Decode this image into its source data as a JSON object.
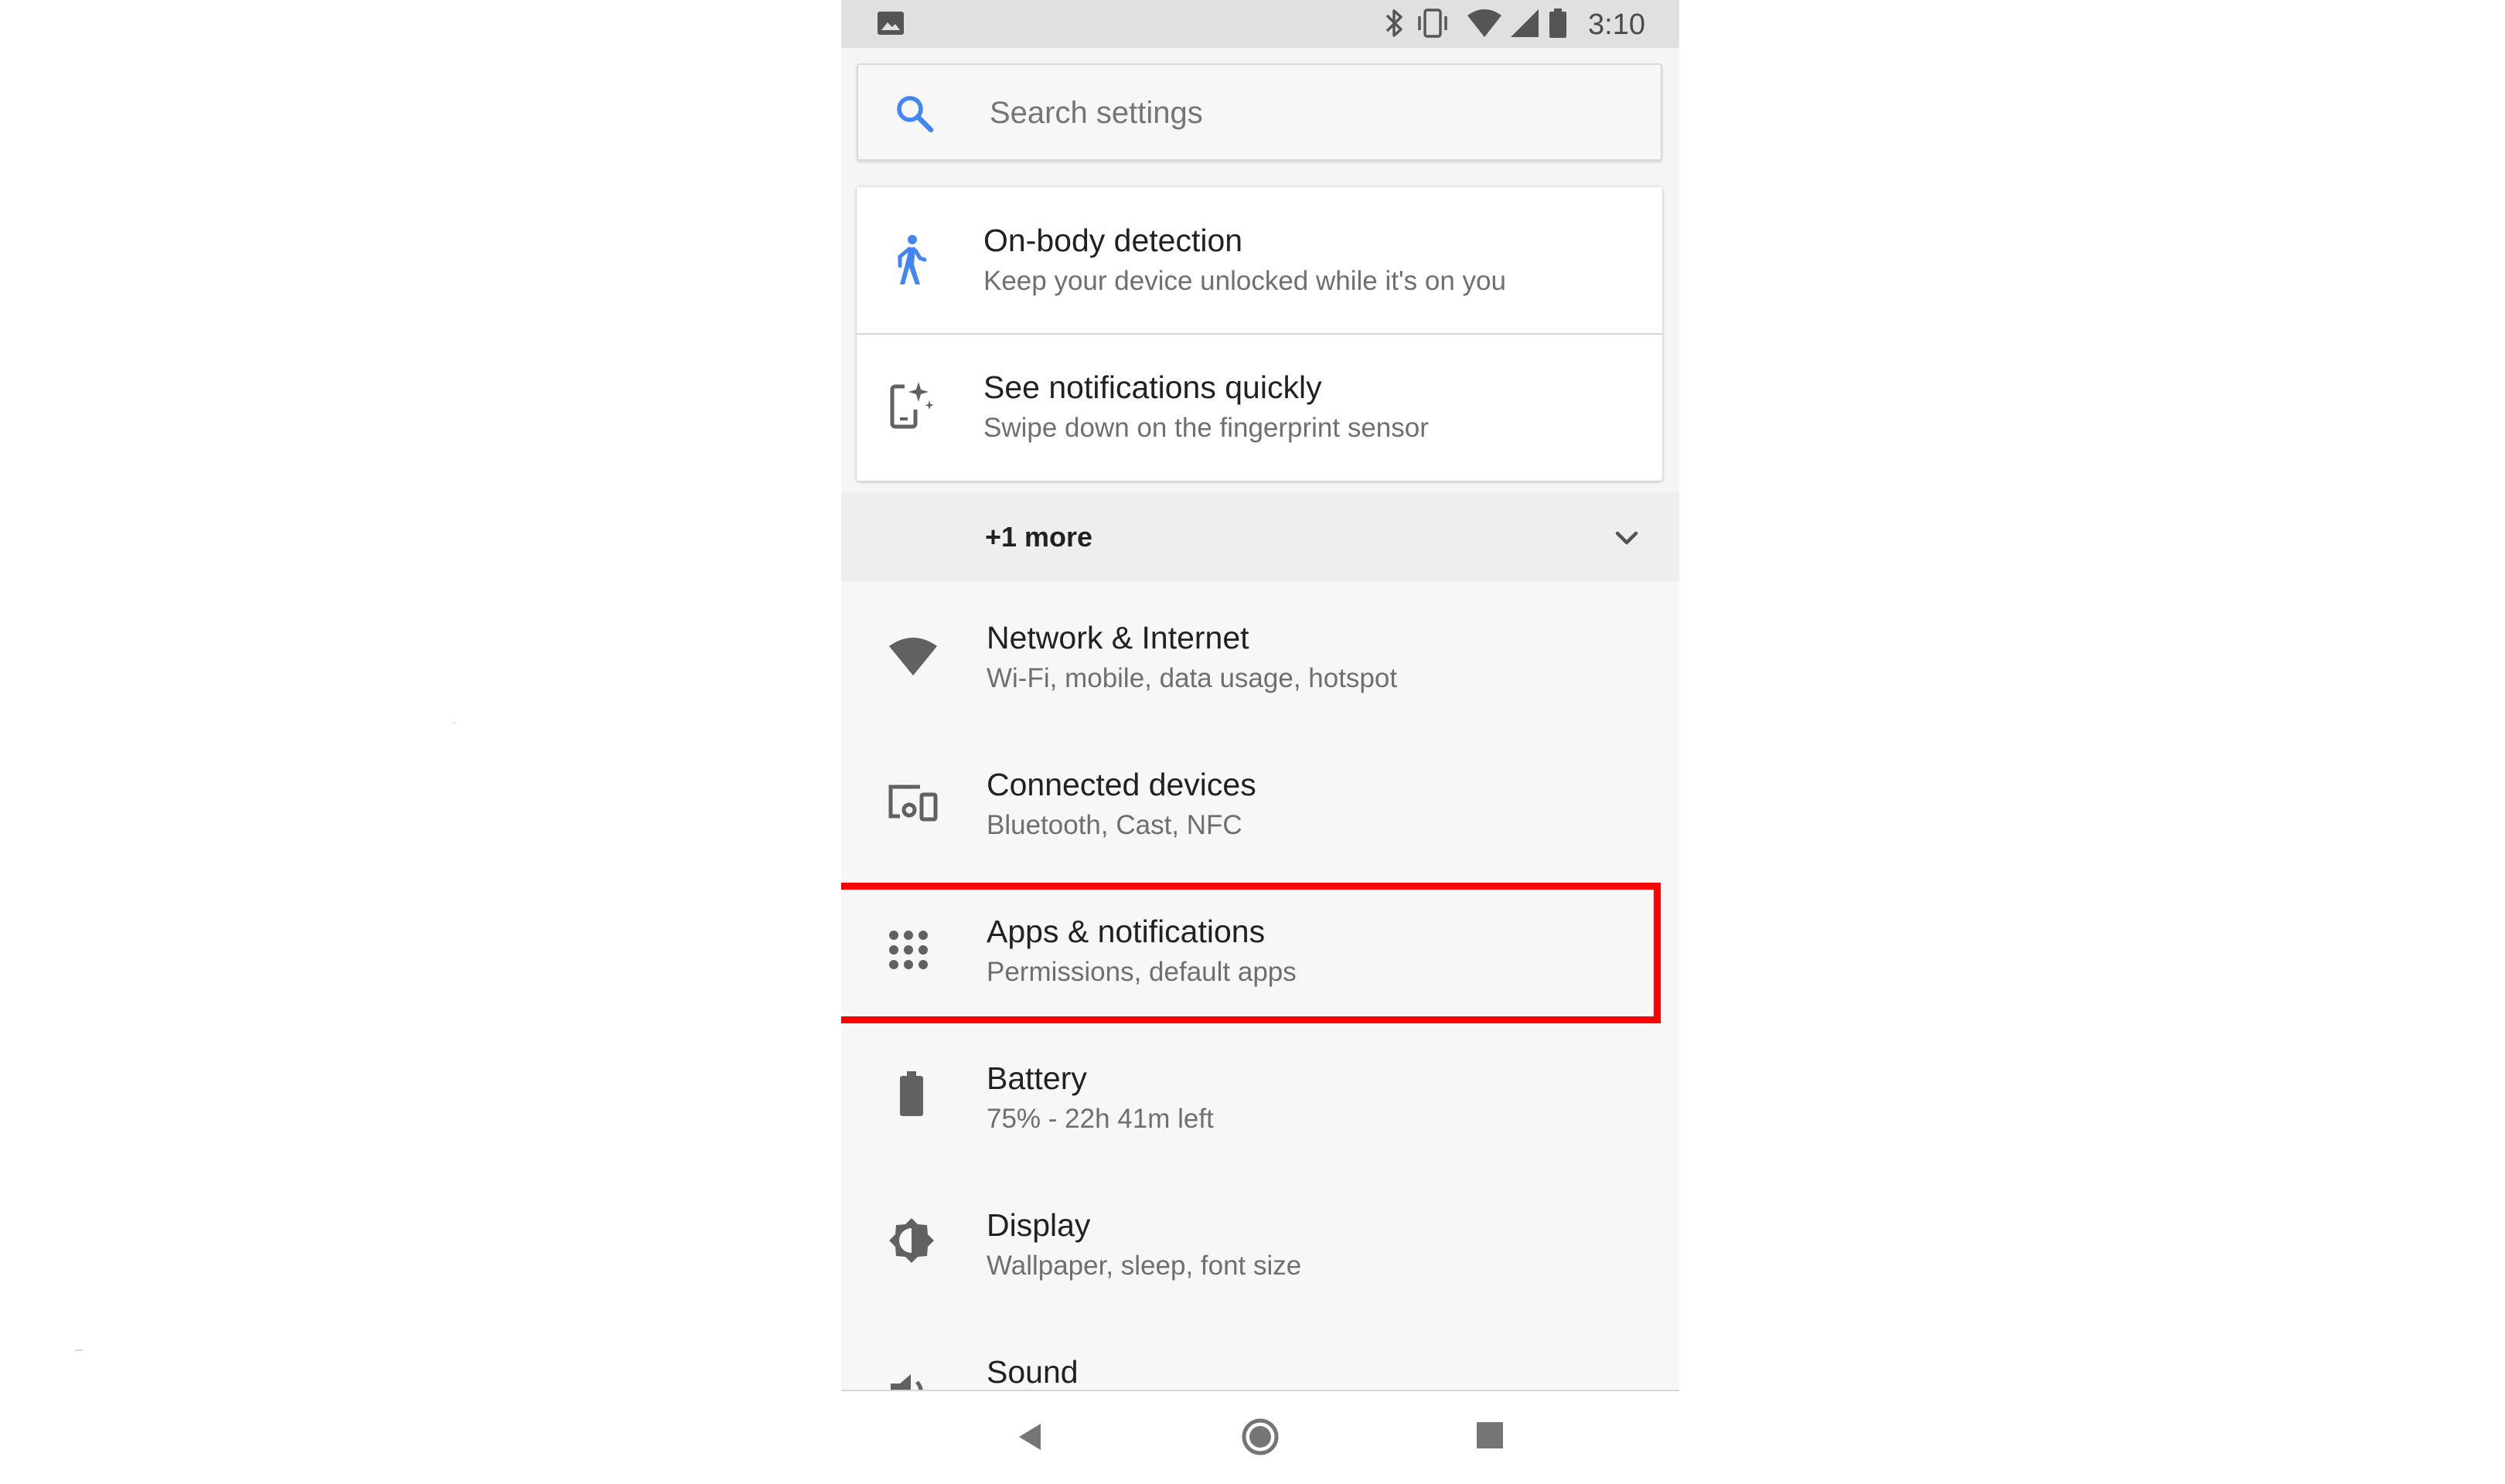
{
  "status_bar": {
    "time": "3:10",
    "icons": [
      "image-icon",
      "bluetooth-icon",
      "vibrate-icon",
      "wifi-icon",
      "cell-signal-icon",
      "battery-icon"
    ]
  },
  "search": {
    "placeholder": "Search settings",
    "icon": "search-icon"
  },
  "suggestions": [
    {
      "title": "On-body detection",
      "subtitle": "Keep your device unlocked while it's on you",
      "icon": "walking-person-icon"
    },
    {
      "title": "See notifications quickly",
      "subtitle": "Swipe down on the fingerprint sensor",
      "icon": "phone-gesture-icon"
    }
  ],
  "more": {
    "label": "+1 more",
    "icon": "chevron-down-icon"
  },
  "settings": [
    {
      "title": "Network & Internet",
      "subtitle": "Wi-Fi, mobile, data usage, hotspot",
      "icon": "wifi-icon"
    },
    {
      "title": "Connected devices",
      "subtitle": "Bluetooth, Cast, NFC",
      "icon": "devices-icon"
    },
    {
      "title": "Apps & notifications",
      "subtitle": "Permissions, default apps",
      "icon": "apps-grid-icon",
      "highlighted": true
    },
    {
      "title": "Battery",
      "subtitle": "75% - 22h 41m left",
      "icon": "battery-icon"
    },
    {
      "title": "Display",
      "subtitle": "Wallpaper, sleep, font size",
      "icon": "brightness-icon"
    },
    {
      "title": "Sound",
      "subtitle": "",
      "icon": "volume-icon"
    }
  ],
  "nav_bar": {
    "buttons": [
      "back-icon",
      "home-icon",
      "recents-icon"
    ]
  },
  "colors": {
    "accent_blue": "#4285f4",
    "highlight_red": "#ff0000",
    "icon_gray": "#616161",
    "list_background": "#f7f7f7",
    "status_bar": "#e0e0e0"
  }
}
